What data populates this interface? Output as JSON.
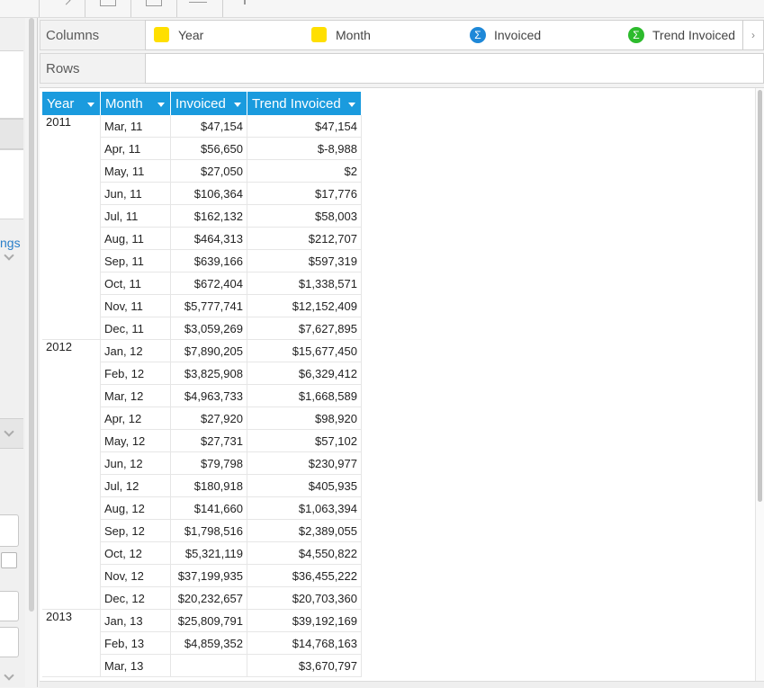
{
  "shelves": {
    "columns_label": "Columns",
    "rows_label": "Rows",
    "pills": [
      {
        "label": "Year",
        "kind": "dimension"
      },
      {
        "label": "Month",
        "kind": "dimension"
      },
      {
        "label": "Invoiced",
        "kind": "measure",
        "color": "#1e88d8"
      },
      {
        "label": "Trend Invoiced",
        "kind": "measure",
        "color": "#2dbb2d"
      }
    ],
    "scroll_glyph": "›"
  },
  "sidebar": {
    "link_text": "ngs"
  },
  "grid": {
    "headers": [
      "Year",
      "Month",
      "Invoiced",
      "Trend Invoiced"
    ],
    "header_color": "#1a9bde",
    "groups": [
      {
        "year": "2011",
        "rows": [
          {
            "month": "Mar, 11",
            "invoiced": "$47,154",
            "trend": "$47,154"
          },
          {
            "month": "Apr, 11",
            "invoiced": "$56,650",
            "trend": "$-8,988"
          },
          {
            "month": "May, 11",
            "invoiced": "$27,050",
            "trend": "$2"
          },
          {
            "month": "Jun, 11",
            "invoiced": "$106,364",
            "trend": "$17,776"
          },
          {
            "month": "Jul, 11",
            "invoiced": "$162,132",
            "trend": "$58,003"
          },
          {
            "month": "Aug, 11",
            "invoiced": "$464,313",
            "trend": "$212,707"
          },
          {
            "month": "Sep, 11",
            "invoiced": "$639,166",
            "trend": "$597,319"
          },
          {
            "month": "Oct, 11",
            "invoiced": "$672,404",
            "trend": "$1,338,571"
          },
          {
            "month": "Nov, 11",
            "invoiced": "$5,777,741",
            "trend": "$12,152,409"
          },
          {
            "month": "Dec, 11",
            "invoiced": "$3,059,269",
            "trend": "$7,627,895"
          }
        ]
      },
      {
        "year": "2012",
        "rows": [
          {
            "month": "Jan, 12",
            "invoiced": "$7,890,205",
            "trend": "$15,677,450"
          },
          {
            "month": "Feb, 12",
            "invoiced": "$3,825,908",
            "trend": "$6,329,412"
          },
          {
            "month": "Mar, 12",
            "invoiced": "$4,963,733",
            "trend": "$1,668,589"
          },
          {
            "month": "Apr, 12",
            "invoiced": "$27,920",
            "trend": "$98,920"
          },
          {
            "month": "May, 12",
            "invoiced": "$27,731",
            "trend": "$57,102"
          },
          {
            "month": "Jun, 12",
            "invoiced": "$79,798",
            "trend": "$230,977"
          },
          {
            "month": "Jul, 12",
            "invoiced": "$180,918",
            "trend": "$405,935"
          },
          {
            "month": "Aug, 12",
            "invoiced": "$141,660",
            "trend": "$1,063,394"
          },
          {
            "month": "Sep, 12",
            "invoiced": "$1,798,516",
            "trend": "$2,389,055"
          },
          {
            "month": "Oct, 12",
            "invoiced": "$5,321,119",
            "trend": "$4,550,822"
          },
          {
            "month": "Nov, 12",
            "invoiced": "$37,199,935",
            "trend": "$36,455,222"
          },
          {
            "month": "Dec, 12",
            "invoiced": "$20,232,657",
            "trend": "$20,703,360"
          }
        ]
      },
      {
        "year": "2013",
        "rows": [
          {
            "month": "Jan, 13",
            "invoiced": "$25,809,791",
            "trend": "$39,192,169"
          },
          {
            "month": "Feb, 13",
            "invoiced": "$4,859,352",
            "trend": "$14,768,163"
          },
          {
            "month": "Mar, 13",
            "invoiced": "",
            "trend": "$3,670,797"
          }
        ]
      }
    ]
  }
}
